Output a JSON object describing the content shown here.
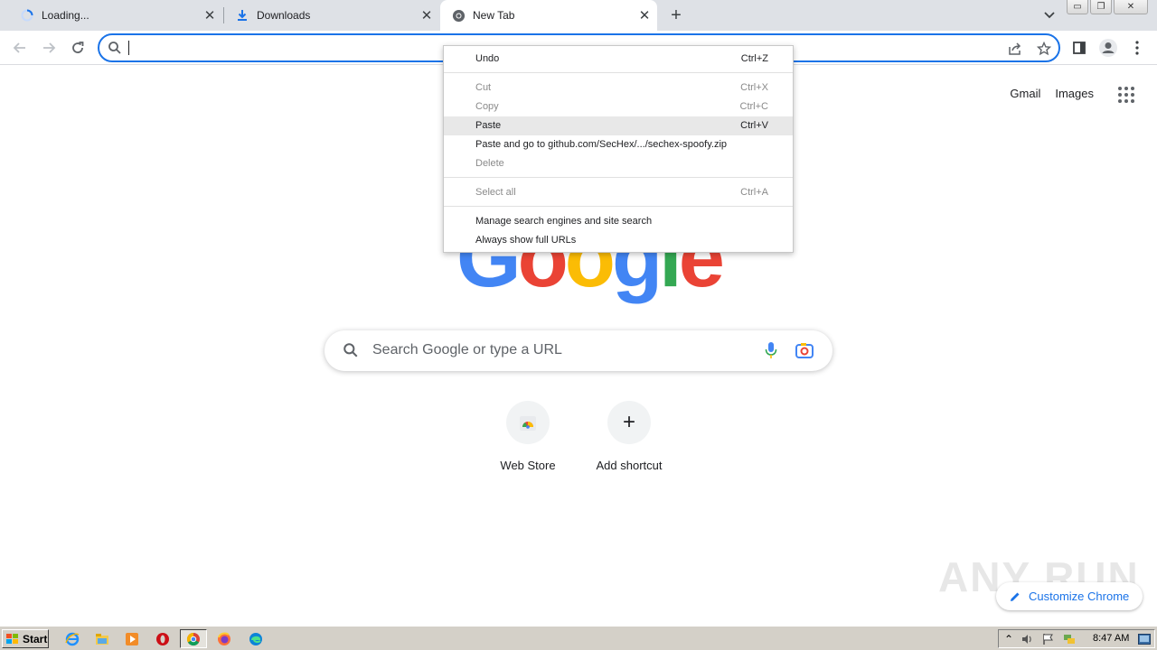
{
  "tabs": [
    {
      "title": "Loading...",
      "icon": "loading-spinner-icon"
    },
    {
      "title": "Downloads",
      "icon": "download-icon"
    },
    {
      "title": "New Tab",
      "icon": "chrome-icon",
      "active": true
    }
  ],
  "omnibox": {
    "value": "",
    "placeholder": ""
  },
  "page": {
    "top_links": [
      "Gmail",
      "Images"
    ],
    "logo": "Google",
    "search_placeholder": "Search Google or type a URL",
    "shortcuts": [
      {
        "label": "Web Store",
        "icon": "web-store-icon"
      },
      {
        "label": "Add shortcut",
        "icon": "plus-icon"
      }
    ],
    "customize_label": "Customize Chrome",
    "watermark": "ANY RUN"
  },
  "context_menu": {
    "items": [
      {
        "label": "Undo",
        "shortcut": "Ctrl+Z",
        "disabled": false
      },
      {
        "label": "Cut",
        "shortcut": "Ctrl+X",
        "disabled": true
      },
      {
        "label": "Copy",
        "shortcut": "Ctrl+C",
        "disabled": true
      },
      {
        "label": "Paste",
        "shortcut": "Ctrl+V",
        "disabled": false,
        "hover": true
      },
      {
        "label": "Paste and go to github.com/SecHex/.../sechex-spoofy.zip",
        "shortcut": "",
        "disabled": false
      },
      {
        "label": "Delete",
        "shortcut": "",
        "disabled": true
      },
      {
        "label": "Select all",
        "shortcut": "Ctrl+A",
        "disabled": true
      },
      {
        "label": "Manage search engines and site search",
        "shortcut": "",
        "disabled": false
      },
      {
        "label": "Always show full URLs",
        "shortcut": "",
        "disabled": false
      }
    ]
  },
  "taskbar": {
    "start_label": "Start",
    "apps": [
      "internet-explorer-icon",
      "file-explorer-icon",
      "media-player-icon",
      "opera-icon",
      "chrome-icon",
      "firefox-icon",
      "edge-icon"
    ],
    "clock": "8:47 AM"
  },
  "colors": {
    "accent": "#1a73e8",
    "google_blue": "#4285f4",
    "google_red": "#ea4335",
    "google_yellow": "#fbbc05",
    "google_green": "#34a853"
  }
}
